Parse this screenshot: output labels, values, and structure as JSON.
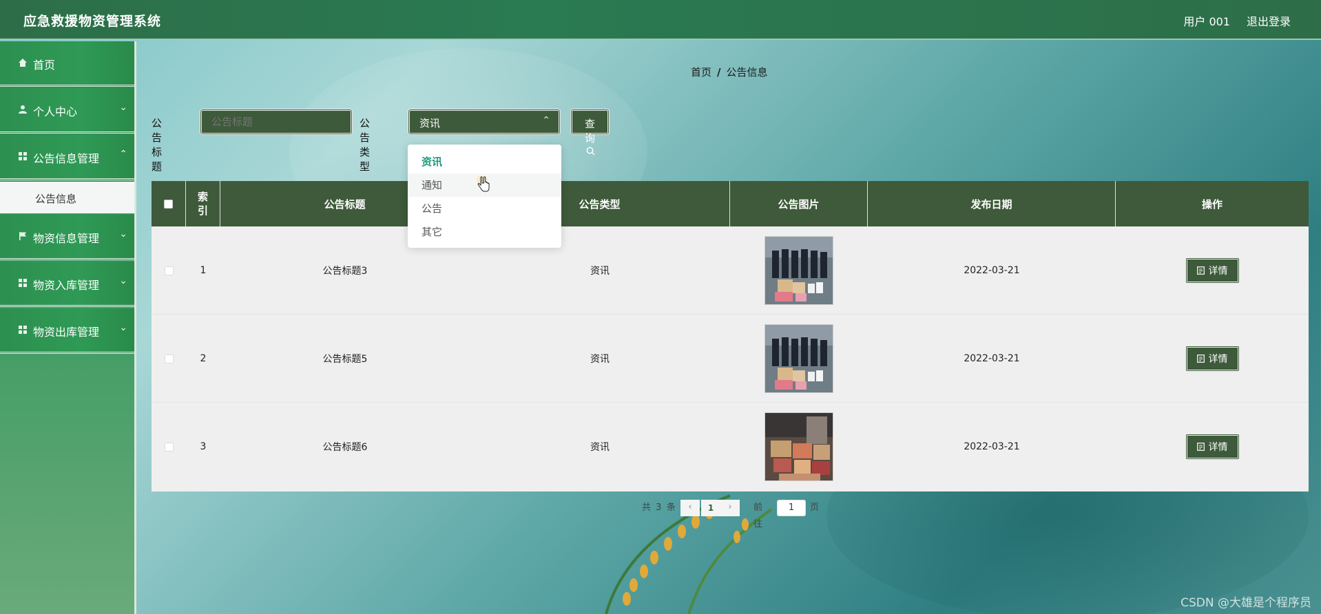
{
  "header": {
    "title": "应急救援物资管理系统",
    "user": "用户 001",
    "logout": "退出登录"
  },
  "sidebar": {
    "items": [
      {
        "label": "首页",
        "icon": "home-icon"
      },
      {
        "label": "个人中心",
        "icon": "user-icon"
      },
      {
        "label": "公告信息管理",
        "icon": "grid-icon"
      },
      {
        "label": "物资信息管理",
        "icon": "flag-icon"
      },
      {
        "label": "物资入库管理",
        "icon": "grid-icon"
      },
      {
        "label": "物资出库管理",
        "icon": "grid-icon"
      }
    ],
    "sub_item": "公告信息"
  },
  "breadcrumb": {
    "home": "首页",
    "sep": "/",
    "current": "公告信息"
  },
  "search": {
    "title_label": "公告标题",
    "title_placeholder": "公告标题",
    "type_label": "公告类型",
    "type_value": "资讯",
    "query_button": "查询"
  },
  "dropdown": {
    "options": [
      "资讯",
      "通知",
      "公告",
      "其它"
    ]
  },
  "table": {
    "headers": [
      "索引",
      "公告标题",
      "公告类型",
      "公告图片",
      "发布日期",
      "操作"
    ],
    "rows": [
      {
        "index": "1",
        "title": "公告标题3",
        "type": "资讯",
        "date": "2022-03-21",
        "action": "详情"
      },
      {
        "index": "2",
        "title": "公告标题5",
        "type": "资讯",
        "date": "2022-03-21",
        "action": "详情"
      },
      {
        "index": "3",
        "title": "公告标题6",
        "type": "资讯",
        "date": "2022-03-21",
        "action": "详情"
      }
    ]
  },
  "pagination": {
    "total_prefix": "共",
    "total": "3",
    "total_suffix": "条",
    "current_page": "1",
    "goto_prefix": "前往",
    "goto_value": "1",
    "goto_suffix": "页"
  },
  "watermark": "CSDN @大雄是个程序员",
  "colors": {
    "header": "#2d6e48",
    "sidebar": "#2e9a55",
    "accent": "#3d5a3a",
    "selected_option": "#1e9b7b"
  }
}
